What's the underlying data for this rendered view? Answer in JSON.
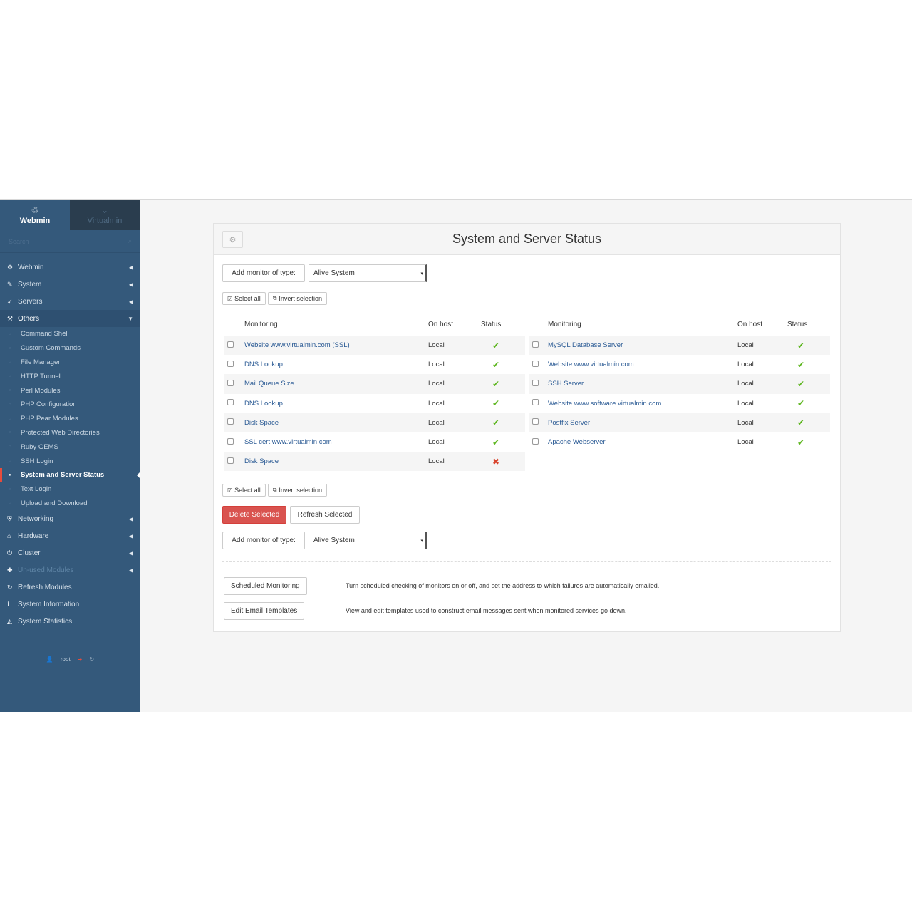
{
  "sidebar": {
    "tabs": [
      {
        "label": "Webmin",
        "icon": "webmin-logo-icon"
      },
      {
        "label": "Virtualmin",
        "icon": "chevron-down-icon"
      }
    ],
    "search_placeholder": "Search",
    "nav": [
      {
        "label": "Webmin",
        "icon": "gear-icon"
      },
      {
        "label": "System",
        "icon": "wrench-icon"
      },
      {
        "label": "Servers",
        "icon": "rocket-icon"
      },
      {
        "label": "Others",
        "icon": "gavel-icon"
      }
    ],
    "others_sub": [
      "Command Shell",
      "Custom Commands",
      "File Manager",
      "HTTP Tunnel",
      "Perl Modules",
      "PHP Configuration",
      "PHP Pear Modules",
      "Protected Web Directories",
      "Ruby GEMS",
      "SSH Login",
      "System and Server Status",
      "Text Login",
      "Upload and Download"
    ],
    "nav_bottom": [
      {
        "label": "Networking",
        "icon": "shield-icon"
      },
      {
        "label": "Hardware",
        "icon": "hdd-icon"
      },
      {
        "label": "Cluster",
        "icon": "power-icon"
      },
      {
        "label": "Un-used Modules",
        "icon": "puzzle-icon"
      },
      {
        "label": "Refresh Modules",
        "icon": "refresh-icon"
      },
      {
        "label": "System Information",
        "icon": "info-icon"
      },
      {
        "label": "System Statistics",
        "icon": "area-chart-icon"
      }
    ],
    "user": "root"
  },
  "panel": {
    "title": "System and Server Status",
    "add_monitor_label": "Add monitor of type:",
    "monitor_type": "Alive System",
    "select_all": "Select all",
    "invert_selection": "Invert selection",
    "delete_selected": "Delete Selected",
    "refresh_selected": "Refresh Selected",
    "columns": {
      "monitoring": "Monitoring",
      "host": "On host",
      "status": "Status"
    },
    "left_rows": [
      {
        "name": "Website www.virtualmin.com (SSL)",
        "host": "Local",
        "status": "up"
      },
      {
        "name": "DNS Lookup",
        "host": "Local",
        "status": "up"
      },
      {
        "name": "Mail Queue Size",
        "host": "Local",
        "status": "up"
      },
      {
        "name": "DNS Lookup",
        "host": "Local",
        "status": "up"
      },
      {
        "name": "Disk Space",
        "host": "Local",
        "status": "up"
      },
      {
        "name": "SSL cert www.virtualmin.com",
        "host": "Local",
        "status": "up"
      },
      {
        "name": "Disk Space",
        "host": "Local",
        "status": "down"
      }
    ],
    "right_rows": [
      {
        "name": "MySQL Database Server",
        "host": "Local",
        "status": "up"
      },
      {
        "name": "Website www.virtualmin.com",
        "host": "Local",
        "status": "up"
      },
      {
        "name": "SSH Server",
        "host": "Local",
        "status": "up"
      },
      {
        "name": "Website www.software.virtualmin.com",
        "host": "Local",
        "status": "up"
      },
      {
        "name": "Postfix Server",
        "host": "Local",
        "status": "up"
      },
      {
        "name": "Apache Webserver",
        "host": "Local",
        "status": "up"
      }
    ],
    "scheduled_label": "Scheduled Monitoring",
    "scheduled_desc": "Turn scheduled checking of monitors on or off, and set the address to which failures are automatically emailed.",
    "email_label": "Edit Email Templates",
    "email_desc": "View and edit templates used to construct email messages sent when monitored services go down."
  },
  "colors": {
    "sidebar": "#34597b",
    "danger": "#d9534f",
    "ok": "#5cb51d",
    "fail": "#d8432c",
    "link": "#2a5a94"
  }
}
